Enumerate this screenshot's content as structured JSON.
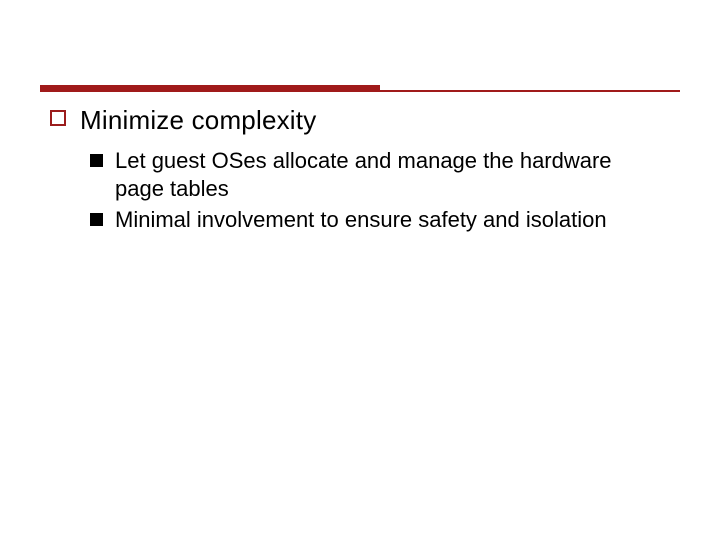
{
  "colors": {
    "accent": "#a01a1a",
    "text": "#000000",
    "background": "#ffffff"
  },
  "slide": {
    "heading": "Minimize complexity",
    "subitems": [
      "Let guest OSes allocate and manage the hardware page tables",
      "Minimal involvement to ensure safety and isolation"
    ]
  }
}
